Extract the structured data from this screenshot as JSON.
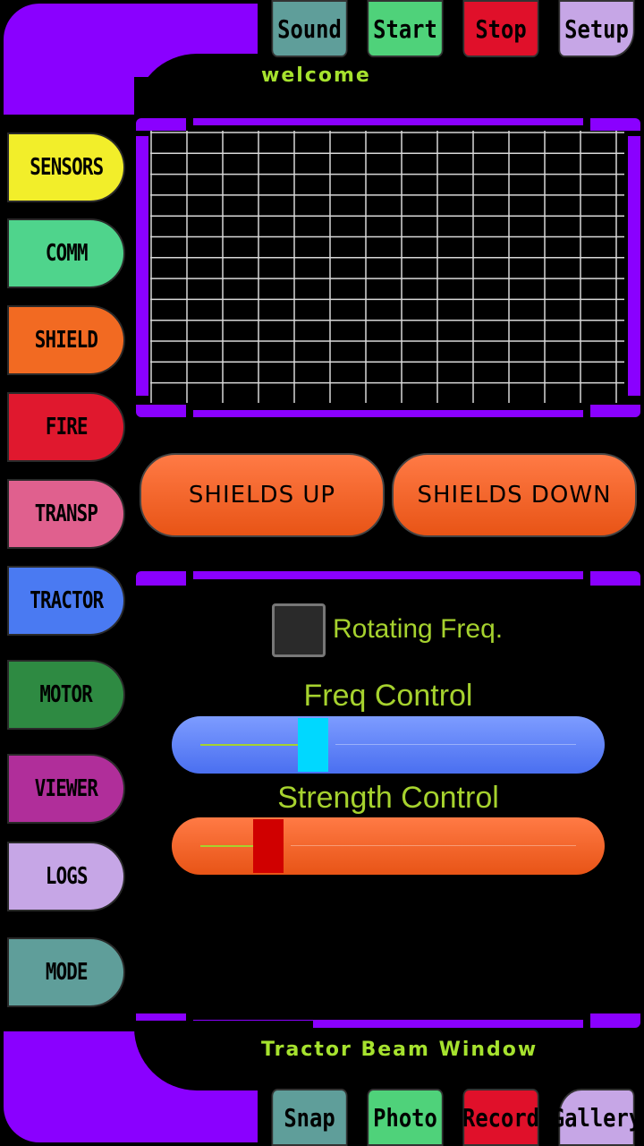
{
  "top_buttons": [
    {
      "label": "Sound",
      "color": "#5f9e9a"
    },
    {
      "label": "Start",
      "color": "#4fd27a"
    },
    {
      "label": "Stop",
      "color": "#e0102a"
    },
    {
      "label": "Setup",
      "color": "#c6a6e6"
    }
  ],
  "header": {
    "welcome": "welcome"
  },
  "sidebar": {
    "items": [
      {
        "label": "SENSORS",
        "color": "#f2ee2a"
      },
      {
        "label": "COMM",
        "color": "#4fd48c"
      },
      {
        "label": "SHIELD",
        "color": "#f26a22"
      },
      {
        "label": "FIRE",
        "color": "#e0182e"
      },
      {
        "label": "TRANSP",
        "color": "#e0608e"
      },
      {
        "label": "TRACTOR",
        "color": "#4a7af2"
      },
      {
        "label": "MOTOR",
        "color": "#2e8a42"
      },
      {
        "label": "VIEWER",
        "color": "#b02e9a"
      },
      {
        "label": "LOGS",
        "color": "#c6a6e6"
      },
      {
        "label": "MODE",
        "color": "#5f9e9a"
      }
    ]
  },
  "shields": {
    "up_label": "SHIELDS UP",
    "down_label": "SHIELDS DOWN"
  },
  "control_panel": {
    "rotating_label": "Rotating Freq.",
    "freq_label": "Freq Control",
    "freq_value_pct": 30,
    "strength_label": "Strength Control",
    "strength_value_pct": 18
  },
  "footer": {
    "title": "Tractor Beam Window"
  },
  "bottom_buttons": [
    {
      "label": "Snap",
      "color": "#5f9e9a"
    },
    {
      "label": "Photo",
      "color": "#4fd27a"
    },
    {
      "label": "Record",
      "color": "#e0102a"
    },
    {
      "label": "Gallery",
      "color": "#c6a6e6"
    }
  ],
  "colors": {
    "frame": "#8a00ff",
    "text_accent": "#a6e22e"
  }
}
